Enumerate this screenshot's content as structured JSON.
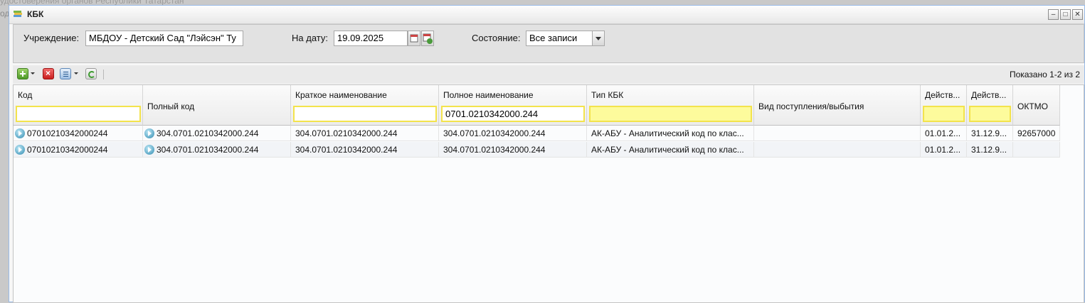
{
  "background": {
    "line1": "удостоверения органов Республики Татарстан",
    "line2": "од"
  },
  "window": {
    "title": "КБК",
    "minimize": "–",
    "maximize": "□",
    "close": "✕"
  },
  "filters": {
    "institution_label": "Учреждение:",
    "institution_value": "МБДОУ - Детский Сад \"Лэйсэн\" Ту",
    "date_label": "На дату:",
    "date_value": "19.09.2025",
    "state_label": "Состояние:",
    "state_value": "Все записи"
  },
  "toolbar": {
    "icons": [
      "add-icon",
      "delete-icon",
      "list-icon",
      "refresh-icon"
    ],
    "paging": "Показано 1-2 из 2"
  },
  "grid": {
    "columns": [
      {
        "title": "Код",
        "filter": ""
      },
      {
        "title": "Полный код"
      },
      {
        "title": "Краткое наименование",
        "filter": ""
      },
      {
        "title": "Полное наименование",
        "filter": "0701.0210342000.244"
      },
      {
        "title": "Тип КБК",
        "filter": ""
      },
      {
        "title": "Вид поступления/выбытия"
      },
      {
        "title": "Действ...",
        "filter": ""
      },
      {
        "title": "Действ...",
        "filter": ""
      },
      {
        "title": "ОКТМО"
      }
    ],
    "rows": [
      {
        "kod": "07010210342000244",
        "full": "304.0701.0210342000.244",
        "short": "304.0701.0210342000.244",
        "name": "304.0701.0210342000.244",
        "type": "АК-АБУ - Аналитический код по клас...",
        "vid": "",
        "from": "01.01.2...",
        "to": "31.12.9...",
        "oktmo": "92657000"
      },
      {
        "kod": "07010210342000244",
        "full": "304.0701.0210342000.244",
        "short": "304.0701.0210342000.244",
        "name": "304.0701.0210342000.244",
        "type": "АК-АБУ - Аналитический код по клас...",
        "vid": "",
        "from": "01.01.2...",
        "to": "31.12.9...",
        "oktmo": ""
      }
    ]
  }
}
